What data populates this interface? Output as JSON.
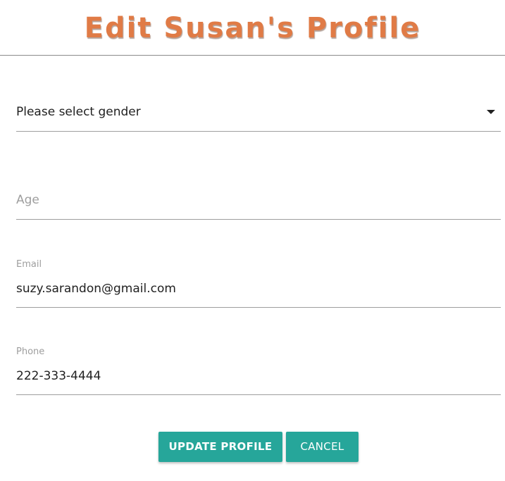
{
  "header": {
    "title": "Edit Susan's Profile"
  },
  "form": {
    "gender": {
      "selected": "Please select gender",
      "icon": "caret-down-icon"
    },
    "age": {
      "placeholder": "Age",
      "value": ""
    },
    "email": {
      "label": "Email",
      "value": "suzy.sarandon@gmail.com"
    },
    "phone": {
      "label": "Phone",
      "value": "222-333-4444"
    }
  },
  "actions": {
    "update_label": "UPDATE PROFILE",
    "cancel_label": "CANCEL"
  },
  "colors": {
    "title": "#e07b46",
    "button": "#26a69a",
    "underline": "#9e9e9e"
  }
}
